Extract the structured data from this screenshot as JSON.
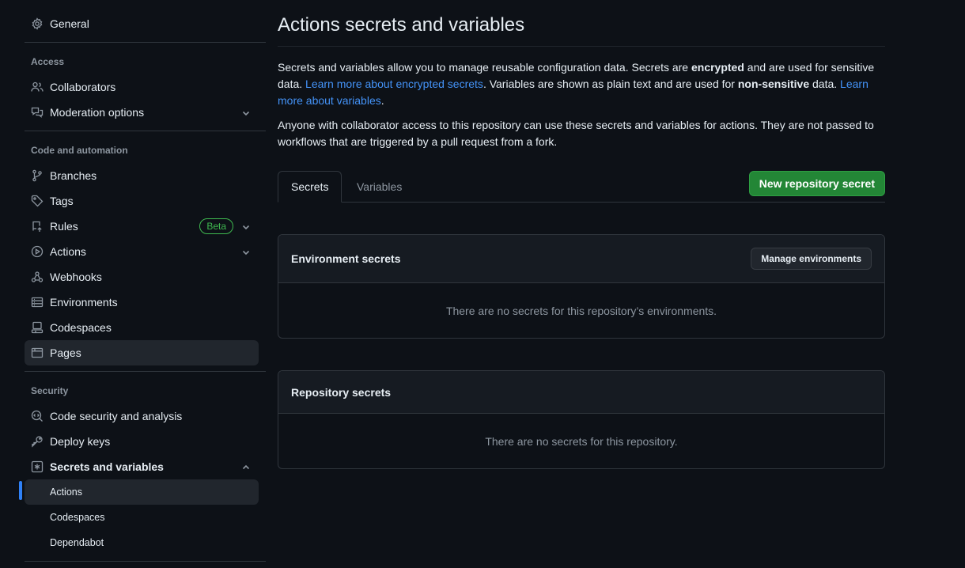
{
  "sidebar": {
    "general": "General",
    "groups": {
      "access": "Access",
      "code": "Code and automation",
      "security": "Security"
    },
    "items": {
      "collaborators": "Collaborators",
      "moderation": "Moderation options",
      "branches": "Branches",
      "tags": "Tags",
      "rules": "Rules",
      "rules_badge": "Beta",
      "actions": "Actions",
      "webhooks": "Webhooks",
      "environments": "Environments",
      "codespaces": "Codespaces",
      "pages": "Pages",
      "code_security": "Code security and analysis",
      "deploy_keys": "Deploy keys",
      "secrets": "Secrets and variables"
    },
    "sub_items": {
      "actions": "Actions",
      "codespaces": "Codespaces",
      "dependabot": "Dependabot"
    }
  },
  "main": {
    "title": "Actions secrets and variables",
    "intro": {
      "p1_a": "Secrets and variables allow you to manage reusable configuration data. Secrets are ",
      "p1_b": "encrypted",
      "p1_c": " and are used for sensitive data. ",
      "p1_link1": "Learn more about encrypted secrets",
      "p1_d": ". Variables are shown as plain text and are used for ",
      "p1_e": "non-sensitive",
      "p1_f": " data. ",
      "p1_link2": "Learn more about variables",
      "p1_g": ".",
      "p2": "Anyone with collaborator access to this repository can use these secrets and variables for actions. They are not passed to workflows that are triggered by a pull request from a fork."
    },
    "tabs": [
      "Secrets",
      "Variables"
    ],
    "new_secret_button": "New repository secret",
    "env_box": {
      "title": "Environment secrets",
      "button": "Manage environments",
      "empty": "There are no secrets for this repository’s environments."
    },
    "repo_box": {
      "title": "Repository secrets",
      "empty": "There are no secrets for this repository."
    }
  }
}
